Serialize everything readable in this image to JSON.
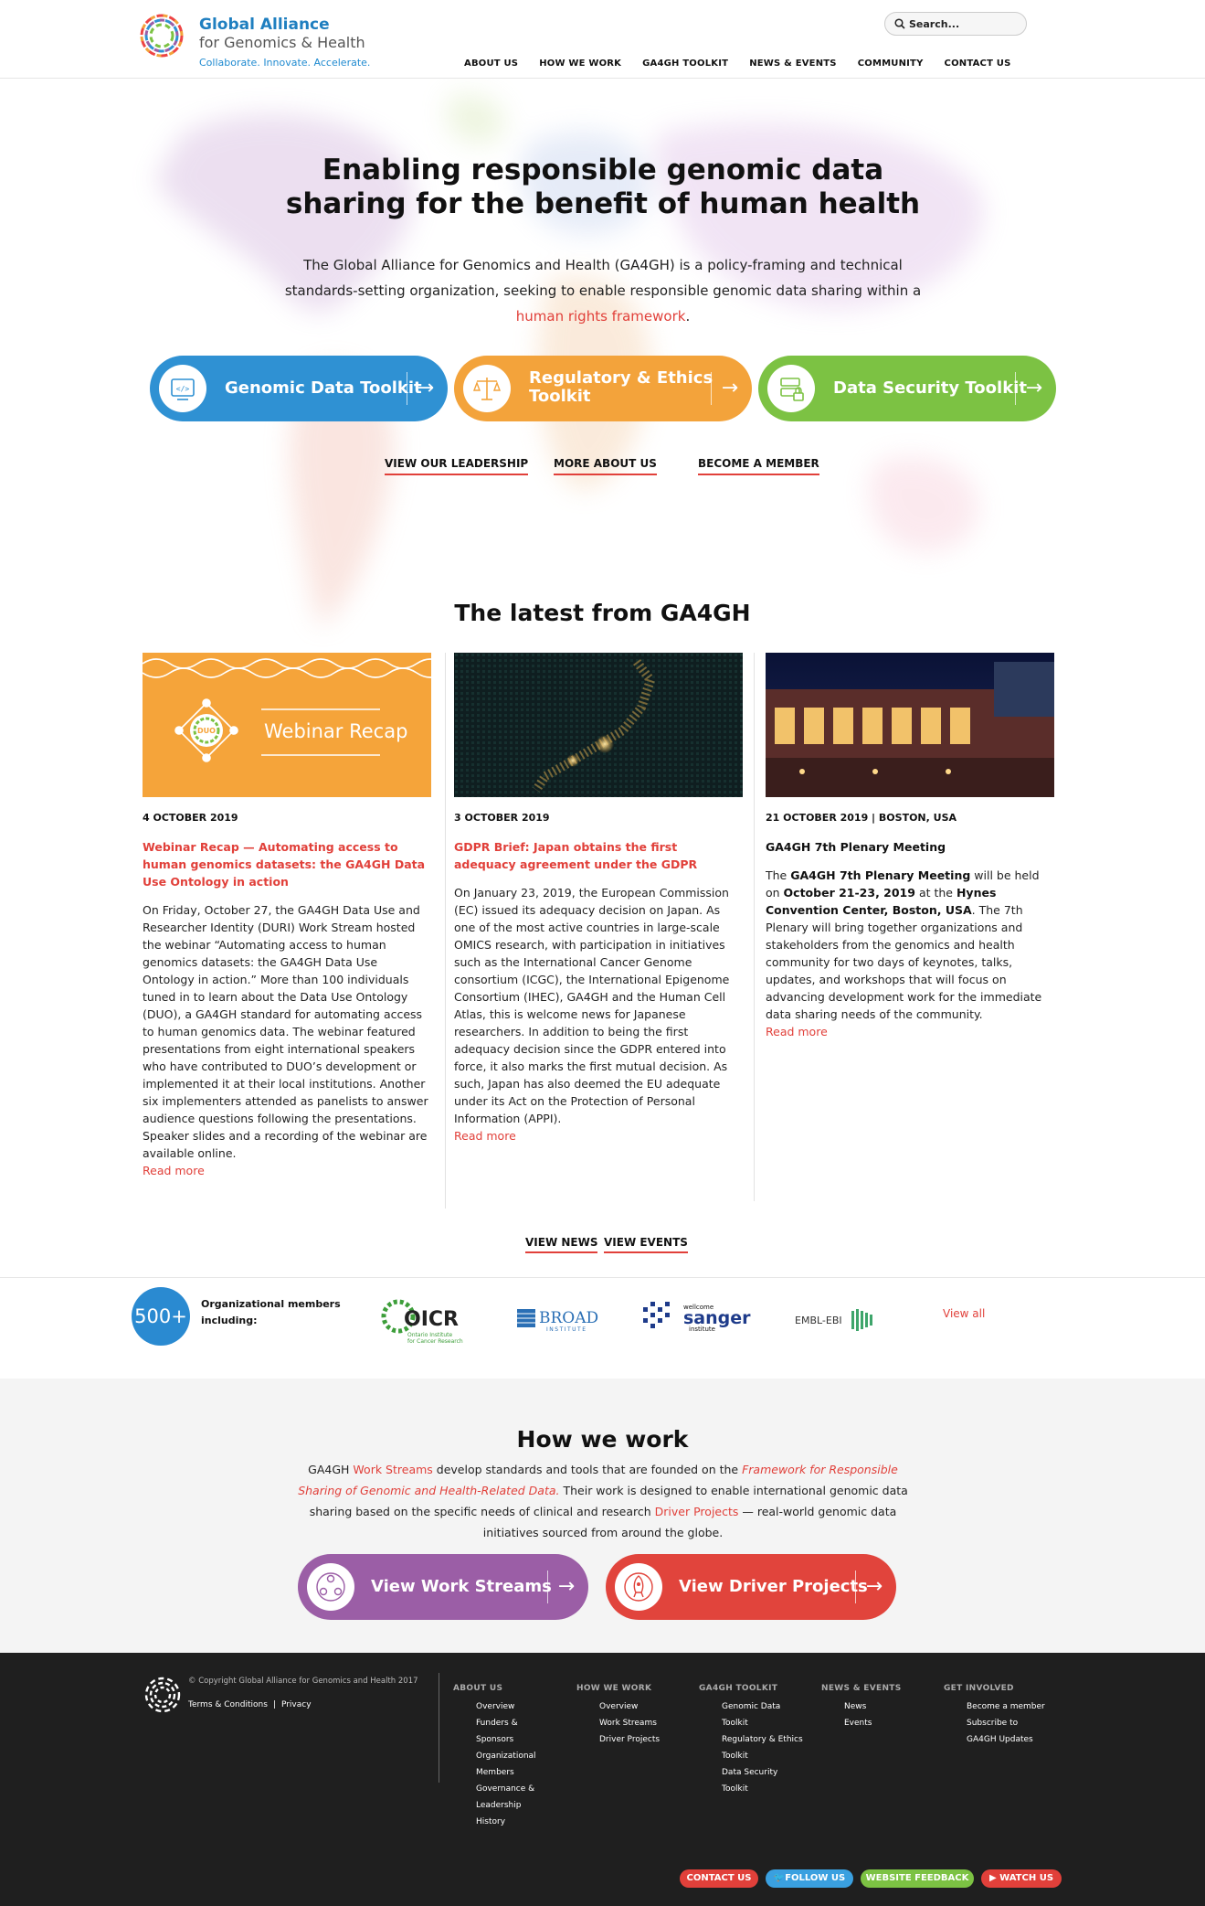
{
  "header": {
    "logo_title": "Global Alliance",
    "logo_subtitle": "for Genomics & Health",
    "logo_tagline": "Collaborate. Innovate. Accelerate.",
    "search_placeholder": "Search...",
    "nav": [
      "ABOUT US",
      "HOW WE WORK",
      "GA4GH TOOLKIT",
      "NEWS & EVENTS",
      "COMMUNITY",
      "CONTACT US"
    ]
  },
  "hero": {
    "title_line1": "Enabling responsible genomic data",
    "title_line2": "sharing for the benefit of human health",
    "text_before": "The Global Alliance for Genomics and Health (GA4GH) is a policy-framing and technical standards-setting organization, seeking to enable responsible genomic data sharing within a ",
    "text_link": "human rights framework",
    "text_after": ".",
    "toolkits": [
      {
        "label": "Genomic Data Toolkit",
        "color": "#2f91d3"
      },
      {
        "label_line1": "Regulatory & Ethics",
        "label_line2": "Toolkit",
        "color": "#f3a33b"
      },
      {
        "label": "Data Security Toolkit",
        "color": "#7cc243"
      }
    ],
    "links": [
      "VIEW OUR LEADERSHIP",
      "MORE ABOUT US",
      "BECOME A MEMBER"
    ]
  },
  "latest": {
    "title": "The latest from GA4GH",
    "items": [
      {
        "image_text": "Webinar Recap",
        "image_badge": "DUO",
        "date": "4 OCTOBER 2019",
        "title": "Webinar Recap — Automating access to human genomics datasets: the GA4GH Data Use Ontology in action",
        "body": "On Friday, October 27, the GA4GH Data Use and Researcher Identity (DURI) Work Stream hosted the webinar “Automating access to human genomics datasets: the GA4GH Data Use Ontology in action.” More than 100 individuals tuned in to learn about the Data Use Ontology (DUO), a GA4GH standard for automating access to human genomics data. The webinar featured presentations from eight international speakers who have contributed to DUO’s development or implemented it at their local institutions. Another six implementers attended as panelists to answer audience questions following the presentations. Speaker slides and a recording of the webinar are available online.",
        "read_more": "Read more"
      },
      {
        "date": "3 OCTOBER 2019",
        "title": "GDPR Brief: Japan obtains the first adequacy agreement under the GDPR",
        "body": "On January 23, 2019, the European Commission (EC) issued its adequacy decision on Japan. As one of the most active countries in large-scale OMICS research, with participation in initiatives such as the International Cancer Genome consortium (ICGC), the International Epigenome Consortium (IHEC), GA4GH and the Human Cell Atlas, this is welcome news for Japanese researchers. In addition to being the first adequacy decision since the GDPR entered into force, it also marks the first mutual decision. As such, Japan has also deemed the EU adequate under its Act on the Protection of Personal Information (APPI).",
        "read_more": "Read more"
      },
      {
        "date": "21 OCTOBER 2019 | BOSTON, USA",
        "title": "GA4GH 7th Plenary Meeting",
        "body_1": "The ",
        "body_b1": "GA4GH 7th Plenary Meeting",
        "body_2": " will be held on ",
        "body_b2": "October 21-23, 2019",
        "body_3": " at the ",
        "body_b3": "Hynes Convention Center, Boston, USA",
        "body_4": ". The 7th Plenary will bring together organizations and stakeholders from the genomics and health community for two days of keynotes, talks, updates, and workshops that will focus on advancing development work for the immediate data sharing needs of the community.",
        "read_more": "Read more"
      }
    ],
    "view_news": "VIEW NEWS",
    "view_events": "VIEW EVENTS"
  },
  "members": {
    "count": "500+",
    "label": "Organizational members including:",
    "logos": [
      {
        "name": "OICR",
        "sub1": "Ontario Institute",
        "sub2": "for Cancer Research"
      },
      {
        "name": "BROAD",
        "sub": "INSTITUTE"
      },
      {
        "name": "sanger",
        "pre": "wellcome",
        "sub": "institute"
      },
      {
        "name": "EMBL-EBI"
      }
    ],
    "view_all": "View all"
  },
  "how_we_work": {
    "title": "How we work",
    "t1": "GA4GH ",
    "work_streams_link": "Work Streams",
    "t2": " develop standards and tools that are founded on the ",
    "framework_link": "Framework for Responsible Sharing of Genomic and Health-Related Data.",
    "t3": " Their work is designed to enable international genomic data sharing based on the specific needs of clinical and research ",
    "driver_link": "Driver Projects",
    "t4": " — real-world genomic data initiatives sourced from around the globe.",
    "buttons": [
      {
        "label": "View Work Streams",
        "color": "#9b5ea6"
      },
      {
        "label": "View Driver Projects",
        "color": "#e1443c"
      }
    ]
  },
  "footer": {
    "copyright": "© Copyright Global Alliance for Genomics and Health 2017",
    "terms": "Terms & Conditions",
    "privacy": "Privacy",
    "columns": [
      {
        "head": "ABOUT US",
        "items": [
          "Overview",
          "Funders &",
          "Sponsors",
          "Organizational",
          "Members",
          "Governance &",
          "Leadership",
          "History"
        ]
      },
      {
        "head": "HOW WE WORK",
        "items": [
          "Overview",
          "Work Streams",
          "Driver Projects"
        ]
      },
      {
        "head": "GA4GH TOOLKIT",
        "items": [
          "Genomic Data",
          "Toolkit",
          "Regulatory & Ethics",
          "Toolkit",
          "Data Security",
          "Toolkit"
        ]
      },
      {
        "head": "NEWS & EVENTS",
        "items": [
          "News",
          "Events"
        ]
      },
      {
        "head": "GET INVOLVED",
        "items": [
          "Become a member",
          "Subscribe to",
          "GA4GH Updates"
        ]
      }
    ],
    "pills": [
      {
        "label": "CONTACT US",
        "color": "#e1403a"
      },
      {
        "label": "FOLLOW US",
        "color": "#3aa0e0"
      },
      {
        "label": "WEBSITE FEEDBACK",
        "color": "#7cc243"
      },
      {
        "label": "WATCH US",
        "color": "#e1403a"
      }
    ]
  }
}
